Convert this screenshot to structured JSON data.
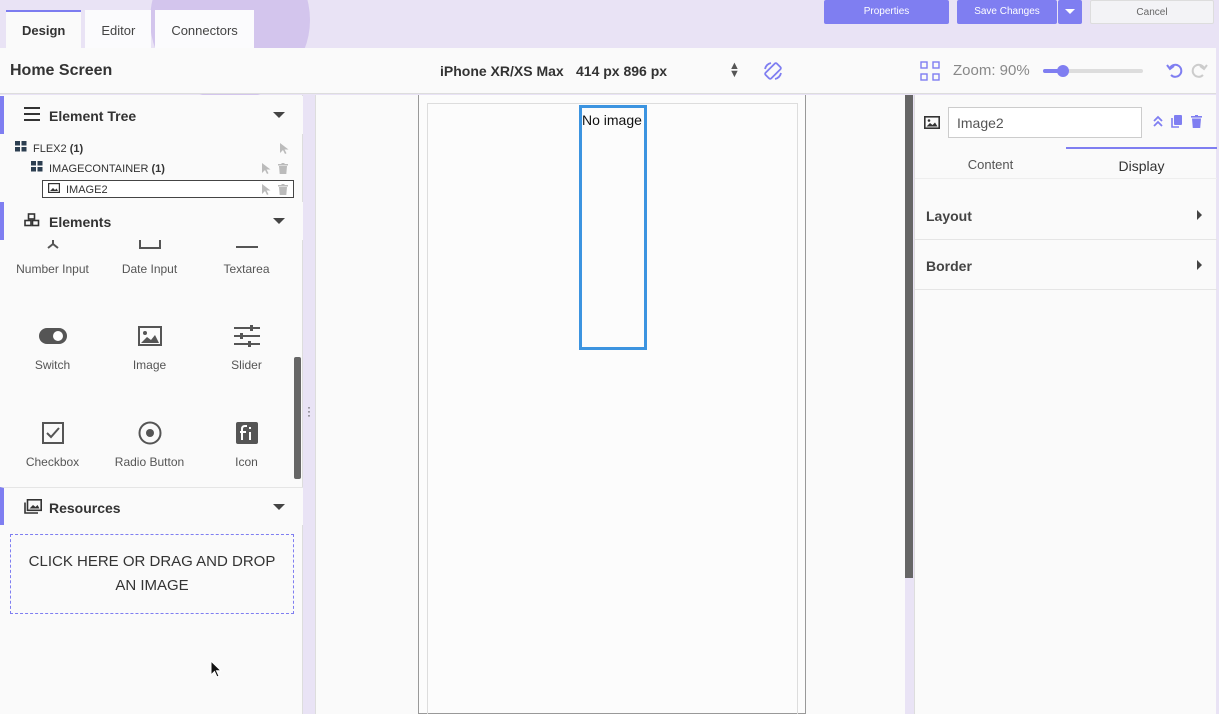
{
  "tabs": [
    {
      "label": "Design"
    },
    {
      "label": "Editor"
    },
    {
      "label": "Connectors"
    }
  ],
  "toolbar": {
    "properties": "Properties",
    "save": "Save Changes",
    "cancel": "Cancel"
  },
  "header": {
    "screen_title": "Home Screen",
    "device": "iPhone XR/XS Max",
    "dims": "414 px 896 px",
    "zoom_label": "Zoom: 90%",
    "zoom_percent": 90
  },
  "element_tree": {
    "title": "Element Tree",
    "nodes": [
      {
        "name": "FLEX2",
        "count": "(1)"
      },
      {
        "name": "IMAGECONTAINER",
        "count": "(1)"
      },
      {
        "name": "IMAGE2"
      }
    ]
  },
  "elements": {
    "title": "Elements",
    "items": [
      {
        "label": "Number Input",
        "icon": "number-input-icon"
      },
      {
        "label": "Date Input",
        "icon": "date-input-icon"
      },
      {
        "label": "Textarea",
        "icon": "textarea-icon"
      },
      {
        "label": "Switch",
        "icon": "switch-icon"
      },
      {
        "label": "Image",
        "icon": "image-icon"
      },
      {
        "label": "Slider",
        "icon": "slider-icon"
      },
      {
        "label": "Checkbox",
        "icon": "checkbox-icon"
      },
      {
        "label": "Radio Button",
        "icon": "radio-button-icon"
      },
      {
        "label": "Icon",
        "icon": "font-icon"
      }
    ]
  },
  "resources": {
    "title": "Resources",
    "dropzone": "CLICK HERE OR DRAG AND DROP AN IMAGE"
  },
  "canvas": {
    "placeholder": "No image"
  },
  "properties_panel": {
    "name_value": "Image2",
    "tabs": [
      {
        "label": "Content"
      },
      {
        "label": "Display"
      }
    ],
    "sections": [
      {
        "label": "Layout"
      },
      {
        "label": "Border"
      }
    ]
  },
  "colors": {
    "accent": "#7f7ef1",
    "selection": "#3c94e0"
  }
}
